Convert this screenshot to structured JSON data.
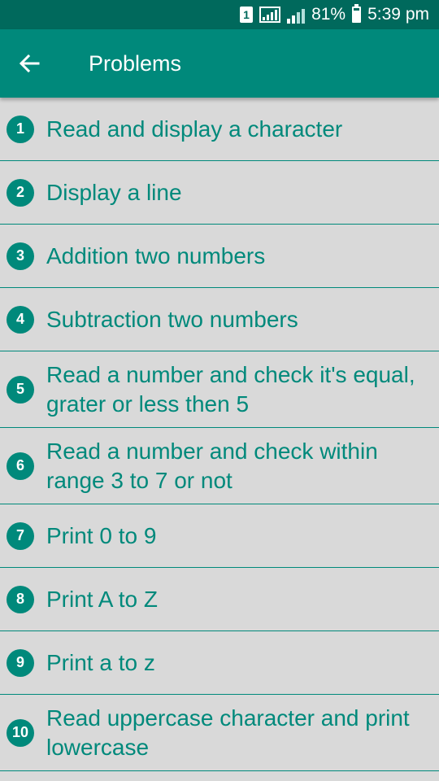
{
  "status": {
    "battery": "81%",
    "time": "5:39 pm",
    "sim": "1",
    "battery_level": 0.81
  },
  "app_bar": {
    "title": "Problems"
  },
  "problems": [
    {
      "number": "1",
      "title": "Read and display a character"
    },
    {
      "number": "2",
      "title": "Display a line"
    },
    {
      "number": "3",
      "title": "Addition two numbers"
    },
    {
      "number": "4",
      "title": "Subtraction two numbers"
    },
    {
      "number": "5",
      "title": "Read a number and check it's equal, grater or less then 5"
    },
    {
      "number": "6",
      "title": "Read a number and check within range 3 to 7 or not"
    },
    {
      "number": "7",
      "title": "Print 0 to 9"
    },
    {
      "number": "8",
      "title": "Print A to Z"
    },
    {
      "number": "9",
      "title": "Print a to z"
    },
    {
      "number": "10",
      "title": "Read uppercase character and print lowercase"
    }
  ],
  "colors": {
    "status_bar": "#00695c",
    "app_bar": "#00897b",
    "accent": "#00897b",
    "background": "#d9d9d9"
  }
}
